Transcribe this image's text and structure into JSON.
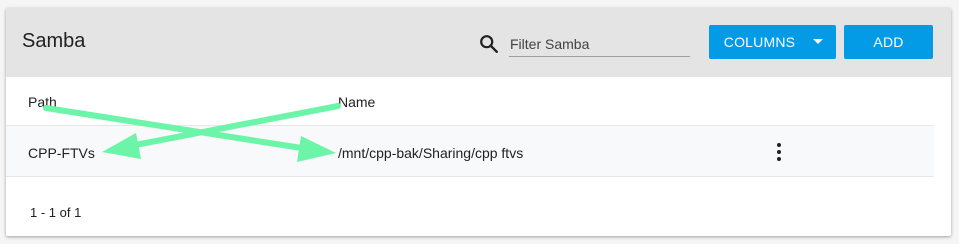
{
  "header": {
    "title": "Samba",
    "search": {
      "icon": "search-icon",
      "placeholder": "Filter Samba",
      "value": ""
    },
    "columns_label": "COLUMNS",
    "add_label": "ADD"
  },
  "table": {
    "columns": [
      "Path",
      "Name"
    ],
    "rows": [
      {
        "path": "CPP-FTVs",
        "name": "/mnt/cpp-bak/Sharing/cpp ftvs",
        "menu_icon": "more-vert-icon"
      }
    ]
  },
  "footer": {
    "pagination": "1 - 1 of 1"
  },
  "colors": {
    "accent": "#039be5",
    "annotation_arrow": "#6cf5a8",
    "header_bg": "#e4e4e4"
  }
}
